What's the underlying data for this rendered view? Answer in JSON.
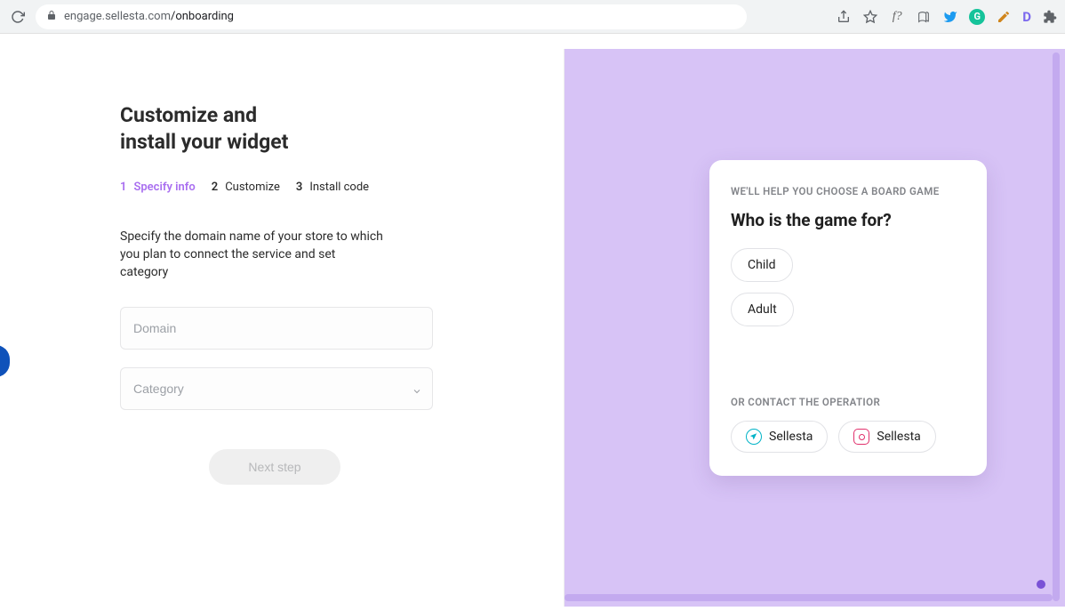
{
  "browser": {
    "url_host": "engage.sellesta.com",
    "url_path": "/onboarding"
  },
  "page": {
    "title_line1": "Customize and",
    "title_line2": "install your widget"
  },
  "steps": [
    {
      "num": "1",
      "label": "Specify info",
      "active": true
    },
    {
      "num": "2",
      "label": "Customize",
      "active": false
    },
    {
      "num": "3",
      "label": "Install code",
      "active": false
    }
  ],
  "help_text": "Specify the domain name of your store to which you plan to connect the service and set category",
  "fields": {
    "domain_placeholder": "Domain",
    "category_placeholder": "Category"
  },
  "next_button": "Next step",
  "preview": {
    "eyebrow": "WE'LL HELP YOU CHOOSE A BOARD GAME",
    "question": "Who is the game for?",
    "options": [
      "Child",
      "Adult"
    ],
    "contact_label": "OR CONTACT THE OPERATIOR",
    "contacts": [
      {
        "type": "telegram",
        "label": "Sellesta"
      },
      {
        "type": "instagram",
        "label": "Sellesta"
      }
    ]
  }
}
